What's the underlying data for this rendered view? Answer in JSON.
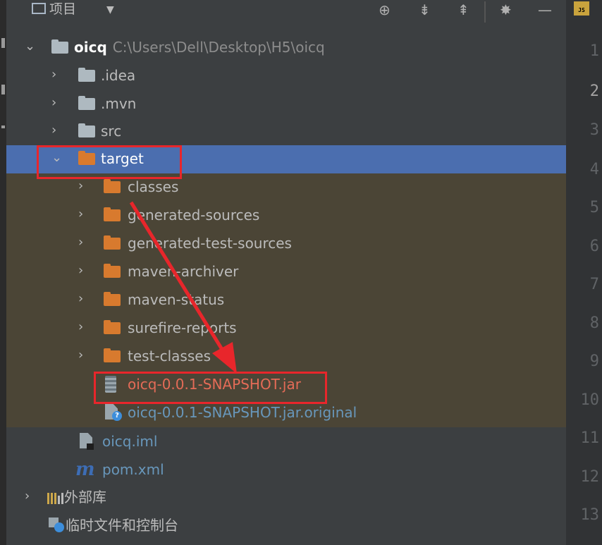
{
  "header": {
    "title": "项目",
    "caret": "▼",
    "icons": [
      "locate-icon",
      "expand-all-icon",
      "collapse-all-icon",
      "gear-icon",
      "minimize-icon"
    ]
  },
  "tree": {
    "root": {
      "name": "oicq",
      "path": "C:\\Users\\Dell\\Desktop\\H5\\oicq"
    },
    "idea": ".idea",
    "mvn": ".mvn",
    "src": "src",
    "target": "target",
    "classes": "classes",
    "generated_sources": "generated-sources",
    "generated_test_sources": "generated-test-sources",
    "maven_archiver": "maven-archiver",
    "maven_status": "maven-status",
    "surefire_reports": "surefire-reports",
    "test_classes": "test-classes",
    "jar": "oicq-0.0.1-SNAPSHOT.jar",
    "jar_original": "oicq-0.0.1-SNAPSHOT.jar.original",
    "iml": "oicq.iml",
    "pom": "pom.xml",
    "ext_libs": "外部库",
    "scratches": "临时文件和控制台"
  },
  "gutter": {
    "file_badge": "JS",
    "line_numbers": [
      "1",
      "2",
      "3",
      "4",
      "5",
      "6",
      "7",
      "8",
      "9",
      "10",
      "11",
      "12",
      "13"
    ]
  },
  "colors": {
    "selection": "#4b6eaf",
    "ignored_bg": "#4b4536",
    "annotation_red": "#e8262b",
    "excluded_text": "#e46b57",
    "folder_orange": "#d87a2e"
  }
}
